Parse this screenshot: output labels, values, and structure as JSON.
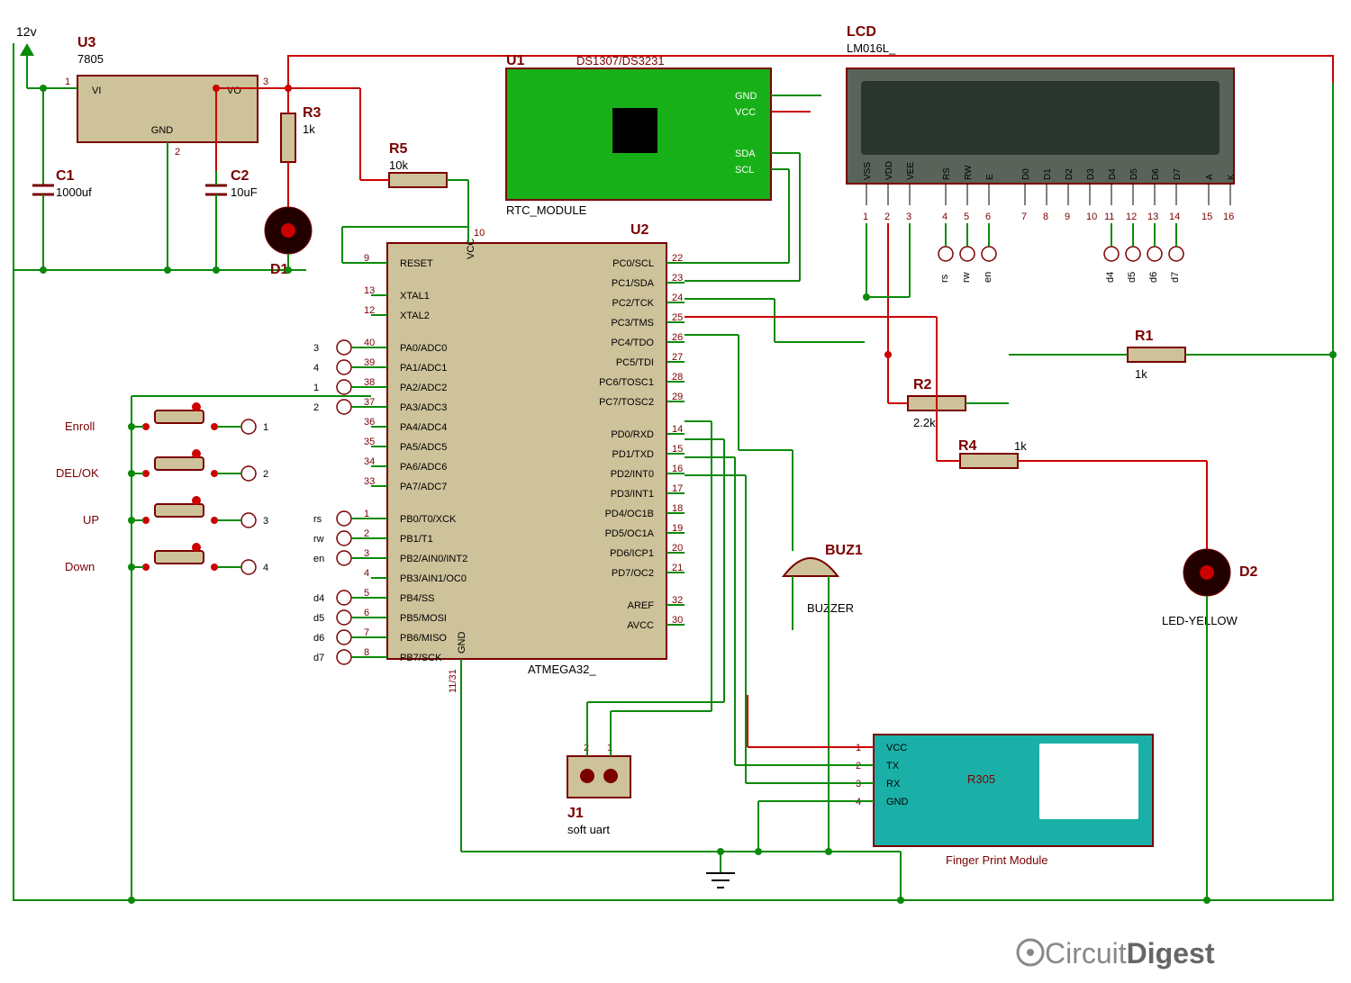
{
  "power": {
    "v12": "12v"
  },
  "u3": {
    "ref": "U3",
    "part": "7805",
    "pins": {
      "vi": "VI",
      "vo": "VO",
      "gnd": "GND"
    },
    "nums": {
      "vi": "1",
      "gnd": "2",
      "vo": "3"
    }
  },
  "c1": {
    "ref": "C1",
    "val": "1000uf"
  },
  "c2": {
    "ref": "C2",
    "val": "10uF"
  },
  "d1": {
    "ref": "D1"
  },
  "d2": {
    "ref": "D2",
    "note": "LED-YELLOW"
  },
  "r1": {
    "ref": "R1",
    "val": "1k"
  },
  "r2": {
    "ref": "R2",
    "val": "2.2k"
  },
  "r3": {
    "ref": "R3",
    "val": "1k"
  },
  "r4": {
    "ref": "R4",
    "val": "1k"
  },
  "r5": {
    "ref": "R5",
    "val": "10k"
  },
  "buz": {
    "ref": "BUZ1",
    "note": "BUZZER"
  },
  "j1": {
    "ref": "J1",
    "note": "soft uart",
    "nums": {
      "1": "1",
      "2": "2"
    }
  },
  "rtc": {
    "ref": "U1",
    "title": "DS1307/DS3231",
    "sub": "RTC_MODULE",
    "pins": [
      "GND",
      "VCC",
      "SDA",
      "SCL"
    ]
  },
  "lcd": {
    "ref": "LCD",
    "part": "LM016L_",
    "pins": [
      "VSS",
      "VDD",
      "VEE",
      "RS",
      "RW",
      "E",
      "D0",
      "D1",
      "D2",
      "D3",
      "D4",
      "D5",
      "D6",
      "D7",
      "A",
      "K"
    ],
    "nums": [
      "1",
      "2",
      "3",
      "4",
      "5",
      "6",
      "7",
      "8",
      "9",
      "10",
      "11",
      "12",
      "13",
      "14",
      "15",
      "16"
    ],
    "tags": [
      "rs",
      "rw",
      "en",
      "d4",
      "d5",
      "d6",
      "d7"
    ]
  },
  "buttons": {
    "enroll": "Enroll",
    "del": "DEL/OK",
    "up": "UP",
    "down": "Down",
    "nums": [
      "1",
      "2",
      "3",
      "4"
    ]
  },
  "fp": {
    "title": "R305",
    "caption": "Finger Print Module",
    "pins": [
      "VCC",
      "TX",
      "RX",
      "GND"
    ],
    "nums": [
      "1",
      "2",
      "3",
      "4"
    ]
  },
  "mcu": {
    "ref": "U2",
    "part": "ATMEGA32_",
    "left": [
      {
        "n": "9",
        "l": "RESET"
      },
      {
        "n": "13",
        "l": "XTAL1"
      },
      {
        "n": "12",
        "l": "XTAL2"
      },
      {
        "n": "40",
        "l": "PA0/ADC0",
        "t": "3"
      },
      {
        "n": "39",
        "l": "PA1/ADC1",
        "t": "4"
      },
      {
        "n": "38",
        "l": "PA2/ADC2",
        "t": "1"
      },
      {
        "n": "37",
        "l": "PA3/ADC3",
        "t": "2"
      },
      {
        "n": "36",
        "l": "PA4/ADC4"
      },
      {
        "n": "35",
        "l": "PA5/ADC5"
      },
      {
        "n": "34",
        "l": "PA6/ADC6"
      },
      {
        "n": "33",
        "l": "PA7/ADC7"
      },
      {
        "n": "1",
        "l": "PB0/T0/XCK",
        "t": "rs"
      },
      {
        "n": "2",
        "l": "PB1/T1",
        "t": "rw"
      },
      {
        "n": "3",
        "l": "PB2/AIN0/INT2",
        "t": "en"
      },
      {
        "n": "4",
        "l": "PB3/AIN1/OC0"
      },
      {
        "n": "5",
        "l": "PB4/SS",
        "t": "d4"
      },
      {
        "n": "6",
        "l": "PB5/MOSI",
        "t": "d5"
      },
      {
        "n": "7",
        "l": "PB6/MISO",
        "t": "d6"
      },
      {
        "n": "8",
        "l": "PB7/SCK",
        "t": "d7"
      }
    ],
    "right": [
      {
        "n": "22",
        "l": "PC0/SCL"
      },
      {
        "n": "23",
        "l": "PC1/SDA"
      },
      {
        "n": "24",
        "l": "PC2/TCK"
      },
      {
        "n": "25",
        "l": "PC3/TMS"
      },
      {
        "n": "26",
        "l": "PC4/TDO"
      },
      {
        "n": "27",
        "l": "PC5/TDI"
      },
      {
        "n": "28",
        "l": "PC6/TOSC1"
      },
      {
        "n": "29",
        "l": "PC7/TOSC2"
      },
      {
        "n": "14",
        "l": "PD0/RXD"
      },
      {
        "n": "15",
        "l": "PD1/TXD"
      },
      {
        "n": "16",
        "l": "PD2/INT0"
      },
      {
        "n": "17",
        "l": "PD3/INT1"
      },
      {
        "n": "18",
        "l": "PD4/OC1B"
      },
      {
        "n": "19",
        "l": "PD5/OC1A"
      },
      {
        "n": "20",
        "l": "PD6/ICP1"
      },
      {
        "n": "21",
        "l": "PD7/OC2"
      },
      {
        "n": "32",
        "l": "AREF"
      },
      {
        "n": "30",
        "l": "AVCC"
      }
    ],
    "top": {
      "vcc": "VCC",
      "n": "10"
    },
    "bot": {
      "gnd": "GND",
      "n": "11/31"
    }
  },
  "brand": {
    "a": "Circuit",
    "b": "Digest"
  }
}
